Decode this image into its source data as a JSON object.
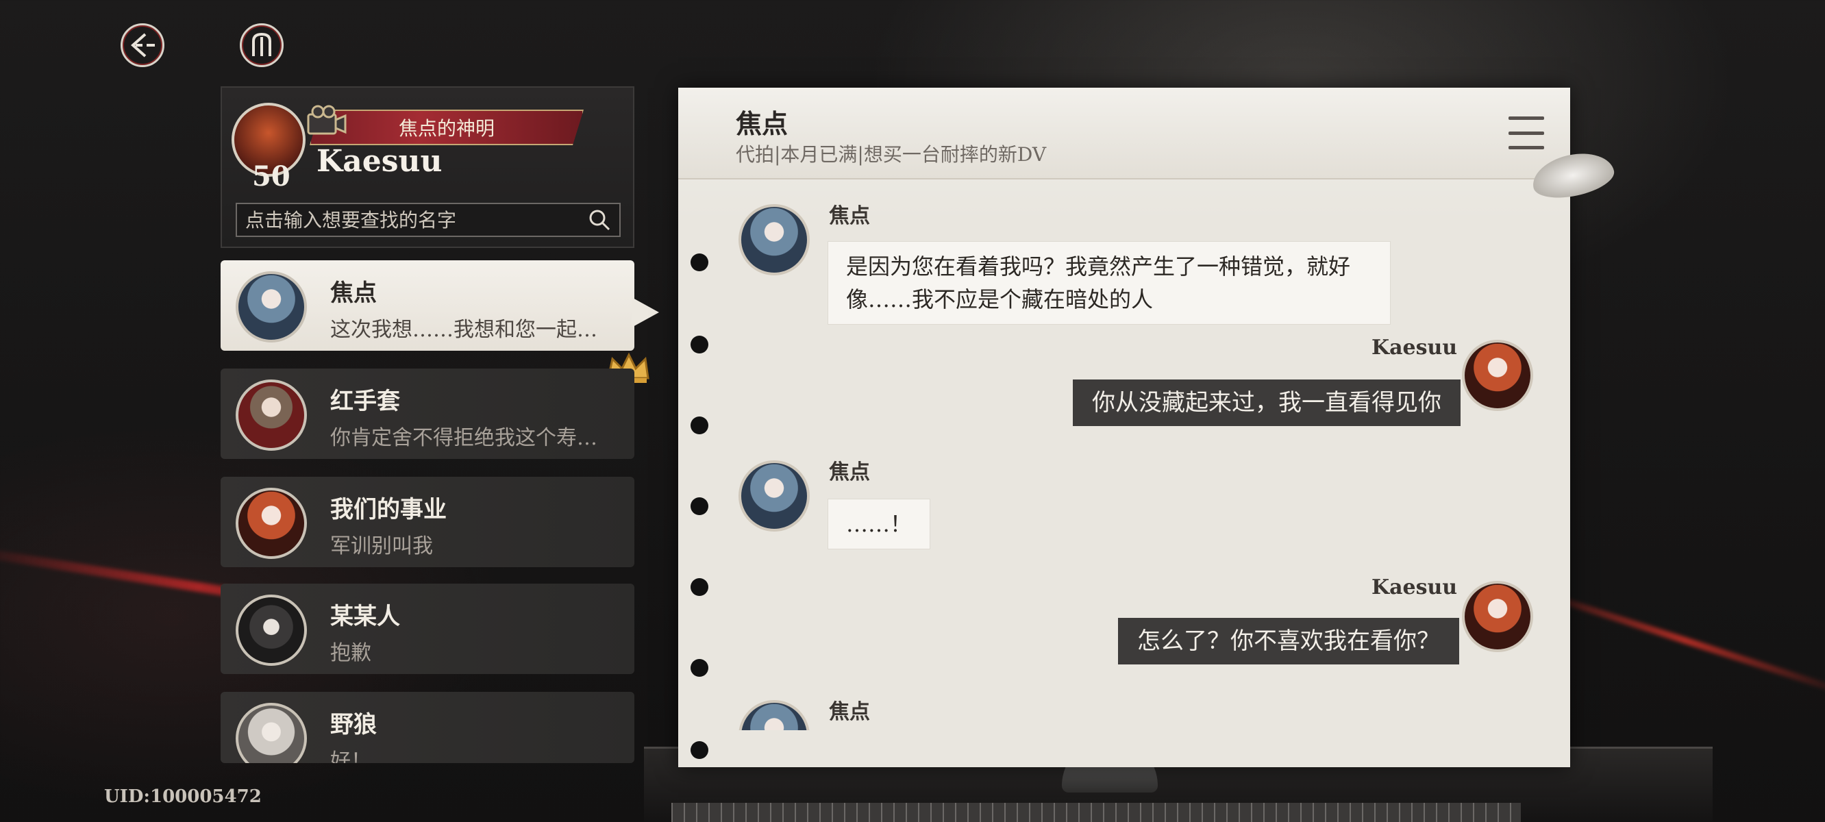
{
  "top_bar": {
    "back_icon": "back-arrow-icon",
    "menu_icon": "crest-menu-icon"
  },
  "profile": {
    "title_badge": "焦点的神明",
    "name": "Kaesuu",
    "level": "50",
    "search_placeholder": "点击输入想要查找的名字"
  },
  "contacts": [
    {
      "name": "焦点",
      "last_message": "这次我想……我想和您一起…",
      "active": true
    },
    {
      "name": "红手套",
      "last_message": "你肯定舍不得拒绝我这个寿…",
      "active": false
    },
    {
      "name": "我们的事业",
      "last_message": "军训别叫我",
      "active": false
    },
    {
      "name": "某某人",
      "last_message": "抱歉",
      "active": false
    },
    {
      "name": "野狼",
      "last_message": "好！",
      "active": false
    }
  ],
  "uid": "UID:100005472",
  "chat": {
    "title": "焦点",
    "subtitle": "代拍|本月已满|想买一台耐摔的新DV",
    "messages": [
      {
        "sender": "焦点",
        "side": "left",
        "text_line1": "是因为您在看着我吗？我竟然产生了一种错觉，就好",
        "text_line2": "像……我不应是个藏在暗处的人"
      },
      {
        "sender": "Kaesuu",
        "side": "right",
        "text": "你从没藏起来过，我一直看得见你"
      },
      {
        "sender": "焦点",
        "side": "left",
        "text": "……！"
      },
      {
        "sender": "Kaesuu",
        "side": "right",
        "text": "怎么了？你不喜欢我在看你？"
      },
      {
        "sender": "焦点",
        "side": "left",
        "text": ""
      }
    ]
  },
  "colors": {
    "accent_red": "#a42c33",
    "paper": "#e9e6df",
    "out_bubble": "#3d3b3a"
  }
}
